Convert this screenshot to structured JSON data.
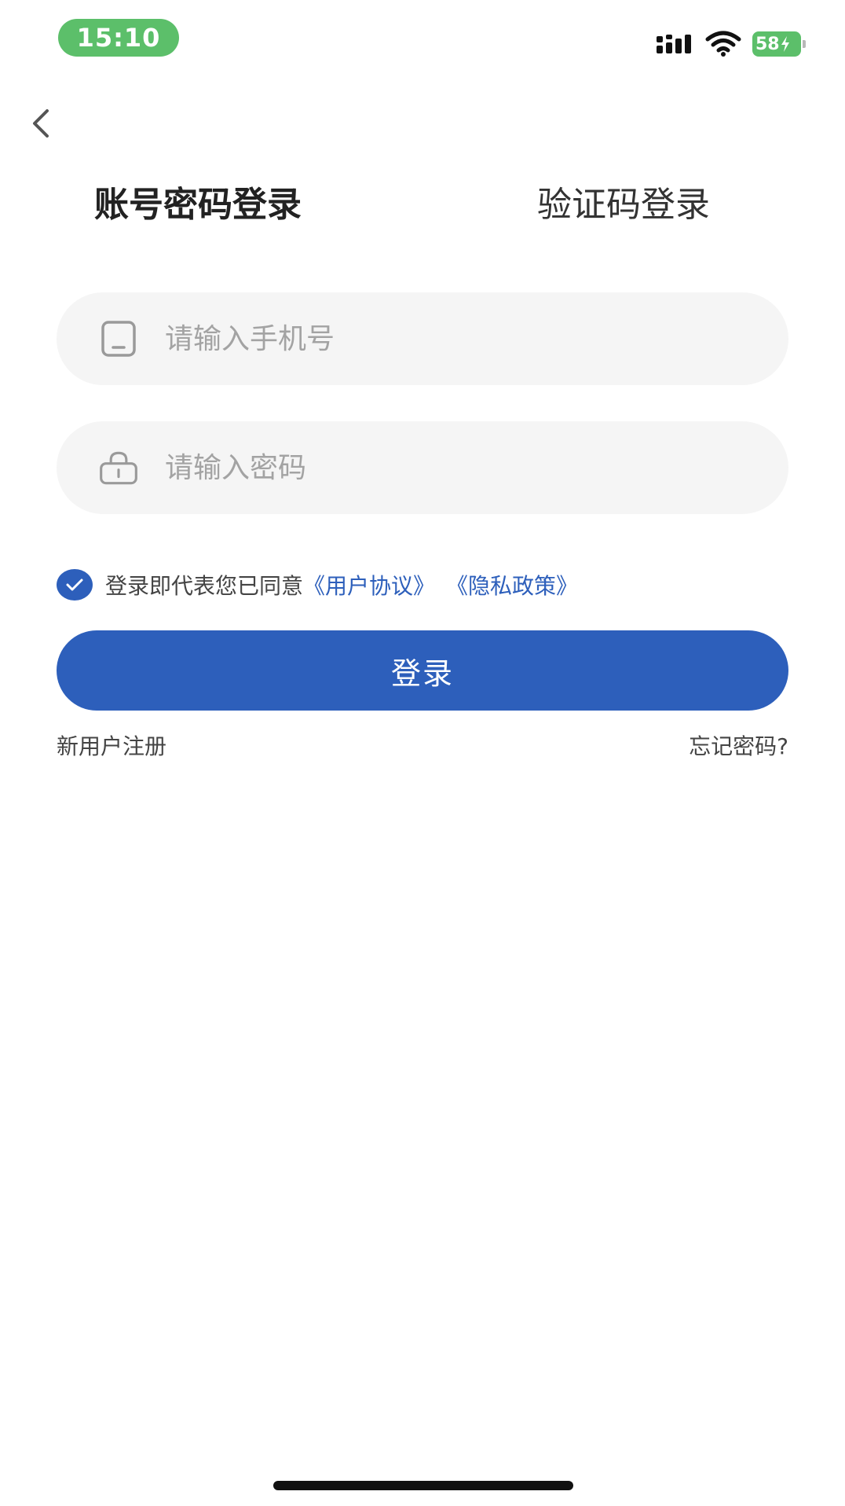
{
  "status_bar": {
    "time": "15:10",
    "battery": "58"
  },
  "tabs": [
    {
      "label": "账号密码登录",
      "active": true
    },
    {
      "label": "验证码登录",
      "active": false
    }
  ],
  "form": {
    "phone": {
      "value": "",
      "placeholder": "请输入手机号"
    },
    "password": {
      "value": "",
      "placeholder": "请输入密码"
    }
  },
  "agreement": {
    "checked": true,
    "text": "登录即代表您已同意",
    "user_agreement": "《用户协议》",
    "privacy_policy": "《隐私政策》"
  },
  "login_button": "登录",
  "register_link": "新用户注册",
  "forgot_link": "忘记密码?",
  "colors": {
    "primary": "#2d5fbb",
    "status_green": "#5cbf6a",
    "input_bg": "#f5f5f5",
    "placeholder": "#a3a3a3"
  }
}
